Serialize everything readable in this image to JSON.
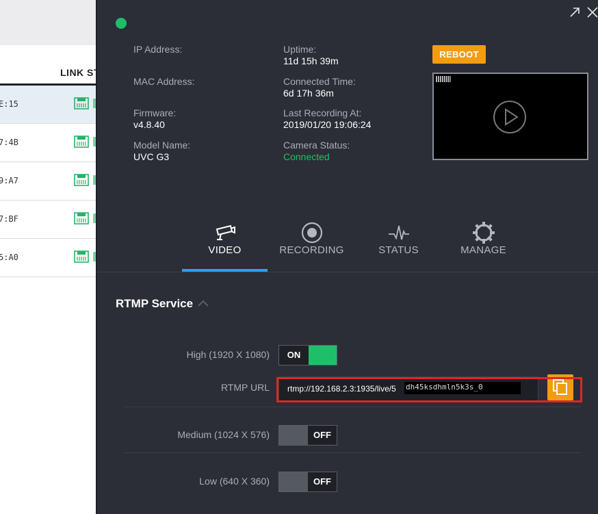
{
  "background_list": {
    "column_header": "LINK ST",
    "rows": [
      {
        "mac_tail": "E:15",
        "selected": true
      },
      {
        "mac_tail": "7:4B",
        "selected": false
      },
      {
        "mac_tail": "9:A7",
        "selected": false
      },
      {
        "mac_tail": "7:BF",
        "selected": false
      },
      {
        "mac_tail": "5:A0",
        "selected": false
      }
    ]
  },
  "camera": {
    "info_left": [
      {
        "label": "IP Address:",
        "value": ""
      },
      {
        "label": "MAC Address:",
        "value": ""
      },
      {
        "label": "Firmware:",
        "value": "v4.8.40"
      },
      {
        "label": "Model Name:",
        "value": "UVC G3"
      }
    ],
    "info_right": [
      {
        "label": "Uptime:",
        "value": "11d 15h 39m"
      },
      {
        "label": "Connected Time:",
        "value": "6d 17h 36m"
      },
      {
        "label": "Last Recording At:",
        "value": "2019/01/20 19:06:24"
      },
      {
        "label": "Camera Status:",
        "value": "Connected"
      }
    ],
    "reboot_label": "REBOOT"
  },
  "tabs": [
    {
      "label": "VIDEO",
      "icon": "camera-icon",
      "active": true
    },
    {
      "label": "RECORDING",
      "icon": "record-icon",
      "active": false
    },
    {
      "label": "STATUS",
      "icon": "pulse-icon",
      "active": false
    },
    {
      "label": "MANAGE",
      "icon": "gear-icon",
      "active": false
    }
  ],
  "rtmp": {
    "section_title": "RTMP Service",
    "high_label": "High (1920 X 1080)",
    "high_state": "ON",
    "url_label": "RTMP URL",
    "url_value": "rtmp://192.168.2.3:1935/live/5",
    "url_masked": "dh45ksdhmln5k3s_0",
    "medium_label": "Medium (1024 X 576)",
    "medium_state": "OFF",
    "low_label": "Low (640 X 360)",
    "low_state": "OFF"
  },
  "colors": {
    "panel_bg": "#2b2e36",
    "accent_green": "#1fbf6a",
    "accent_orange": "#f39c12",
    "tab_active": "#2ea0e6",
    "highlight_red": "#e02626"
  }
}
